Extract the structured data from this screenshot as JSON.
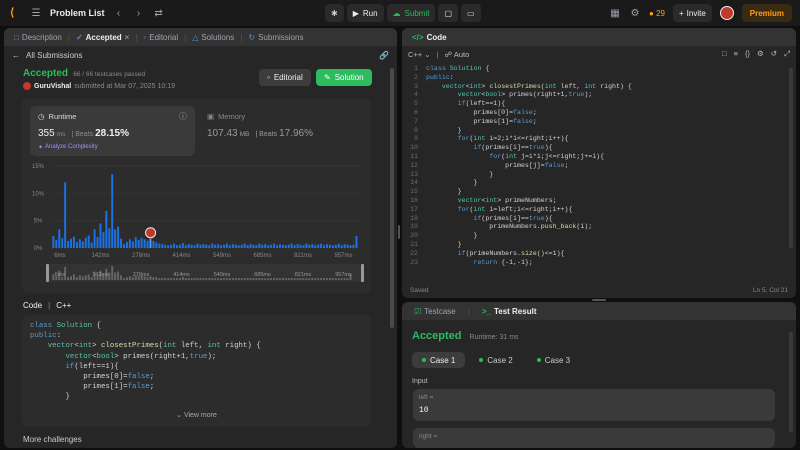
{
  "topbar": {
    "title": "Problem List",
    "run_label": "Run",
    "submit_label": "Submit",
    "streak": "29",
    "invite_label": "Invite",
    "premium_label": "Premium"
  },
  "left_tabs": {
    "description": "Description",
    "accepted": "Accepted",
    "editorial": "Editorial",
    "solutions": "Solutions",
    "submissions": "Submissions"
  },
  "back_label": "All Submissions",
  "result": {
    "status": "Accepted",
    "passed": "66 / 66 testcases passed",
    "user": "GuruVishal",
    "submitted": "submitted at Mar 07, 2025 10:19",
    "editorial_btn": "Editorial",
    "solution_btn": "Solution"
  },
  "runtime": {
    "label": "Runtime",
    "value": "355",
    "unit": "ms",
    "beats_label": "Beats",
    "beats": "28.15%",
    "analyze": "Analyze Complexity"
  },
  "memory": {
    "label": "Memory",
    "value": "107.43",
    "unit": "MB",
    "beats_label": "Beats",
    "beats": "17.96%"
  },
  "chart_data": {
    "type": "bar",
    "y_ticks": [
      "15%",
      "10%",
      "5%",
      "0%"
    ],
    "ylim": [
      0,
      15
    ],
    "x_ticks": [
      "6ms",
      "142ms",
      "278ms",
      "414ms",
      "549ms",
      "685ms",
      "821ms",
      "957ms"
    ],
    "values": [
      2.2,
      1.5,
      3.4,
      1.8,
      12.0,
      1.3,
      1.7,
      2.1,
      1.1,
      1.6,
      1.2,
      1.9,
      2.3,
      1.0,
      3.4,
      2.0,
      4.5,
      2.9,
      6.8,
      3.6,
      13.5,
      3.4,
      3.9,
      1.7,
      0.7,
      1.1,
      1.6,
      1.2,
      2.0,
      1.5,
      1.9,
      1.6,
      1.3,
      1.7,
      1.3,
      1.0,
      0.8,
      0.7,
      0.6,
      0.5,
      0.6,
      0.8,
      0.5,
      0.6,
      0.9,
      0.5,
      0.7,
      0.6,
      0.5,
      0.8,
      0.6,
      0.7,
      0.6,
      0.5,
      0.8,
      0.6,
      0.7,
      0.5,
      0.6,
      0.8,
      0.5,
      0.7,
      0.6,
      0.5,
      0.6,
      0.8,
      0.5,
      0.7,
      0.6,
      0.5,
      0.8,
      0.6,
      0.7,
      0.5,
      0.6,
      0.8,
      0.5,
      0.7,
      0.6,
      0.5,
      0.6,
      0.8,
      0.5,
      0.7,
      0.6,
      0.5,
      0.8,
      0.6,
      0.7,
      0.5,
      0.6,
      0.8,
      0.5,
      0.7,
      0.6,
      0.5,
      0.6,
      0.8,
      0.5,
      0.7,
      0.6,
      0.5,
      0.6,
      2.2
    ],
    "highlight_index": 33,
    "minimap_values": [
      0.6,
      0.4,
      1.0,
      0.3,
      1.4,
      0.3,
      0.4,
      0.6,
      0.3,
      0.5,
      0.4,
      0.5,
      0.6,
      0.3,
      0.9,
      0.5,
      1.0,
      0.6,
      1.2,
      0.8,
      1.5,
      0.8,
      0.9,
      0.5,
      0.2,
      0.3,
      0.4,
      0.3,
      0.5,
      0.4,
      0.5,
      0.4,
      0.3,
      0.4,
      0.3,
      0.3,
      0.2,
      0.2,
      0.2,
      0.2,
      0.2,
      0.2,
      0.2,
      0.2,
      0.3,
      0.2,
      0.2,
      0.2,
      0.2,
      0.2,
      0.2,
      0.2,
      0.2,
      0.2,
      0.2,
      0.2,
      0.2,
      0.2,
      0.2,
      0.2,
      0.2,
      0.2,
      0.2,
      0.2,
      0.2,
      0.2,
      0.2,
      0.2,
      0.2,
      0.2,
      0.2,
      0.2,
      0.2,
      0.2,
      0.2,
      0.2,
      0.2,
      0.2,
      0.2,
      0.2,
      0.2,
      0.2,
      0.2,
      0.2,
      0.2,
      0.2,
      0.2,
      0.2,
      0.2,
      0.2,
      0.2,
      0.2,
      0.2,
      0.2,
      0.2,
      0.2,
      0.2,
      0.2,
      0.2,
      0.2,
      0.2,
      0.6
    ],
    "colors": {
      "bar": "#1a73e8",
      "highlight": "#4a9cff"
    }
  },
  "code_section": {
    "label": "Code",
    "lang": "C++",
    "view_more": "View more",
    "lines": [
      "class Solution {",
      "public:",
      "    vector<int> closestPrimes(int left, int right) {",
      "        vector<bool> primes(right+1,true);",
      "        if(left==1){",
      "            primes[0]=false;",
      "            primes[1]=false;",
      "        }"
    ]
  },
  "more_challenges": "More challenges",
  "editor": {
    "tab": "Code",
    "lang": "C++",
    "mode": "Auto",
    "status_left": "Saved",
    "status_right": "Ln 5, Col 21",
    "lines": [
      "class Solution {",
      "public:",
      "    vector<int> closestPrimes(int left, int right) {",
      "        vector<bool> primes(right+1,true);",
      "        if(left==1){",
      "            primes[0]=false;",
      "            primes[1]=false;",
      "        }",
      "        for(int i=2;i*i<=right;i++){",
      "            if(primes[i]==true){",
      "                for(int j=i*i;j<=right;j+=i){",
      "                    primes[j]=false;",
      "                }",
      "            }",
      "        }",
      "        vector<int> primeNumbers;",
      "        for(int i=left;i<=right;i++){",
      "            if(primes[i]==true){",
      "                primeNumbers.push_back(i);",
      "            }",
      "        }",
      "        if(primeNumbers.size()<=1){",
      "            return {-1,-1};"
    ]
  },
  "result_panel": {
    "tab_testcase": "Testcase",
    "tab_result": "Test Result",
    "status": "Accepted",
    "runtime": "Runtime: 31 ms",
    "cases": [
      "Case 1",
      "Case 2",
      "Case 3"
    ],
    "input_label": "Input",
    "left_label": "left =",
    "left_value": "10",
    "right_label": "right ="
  }
}
